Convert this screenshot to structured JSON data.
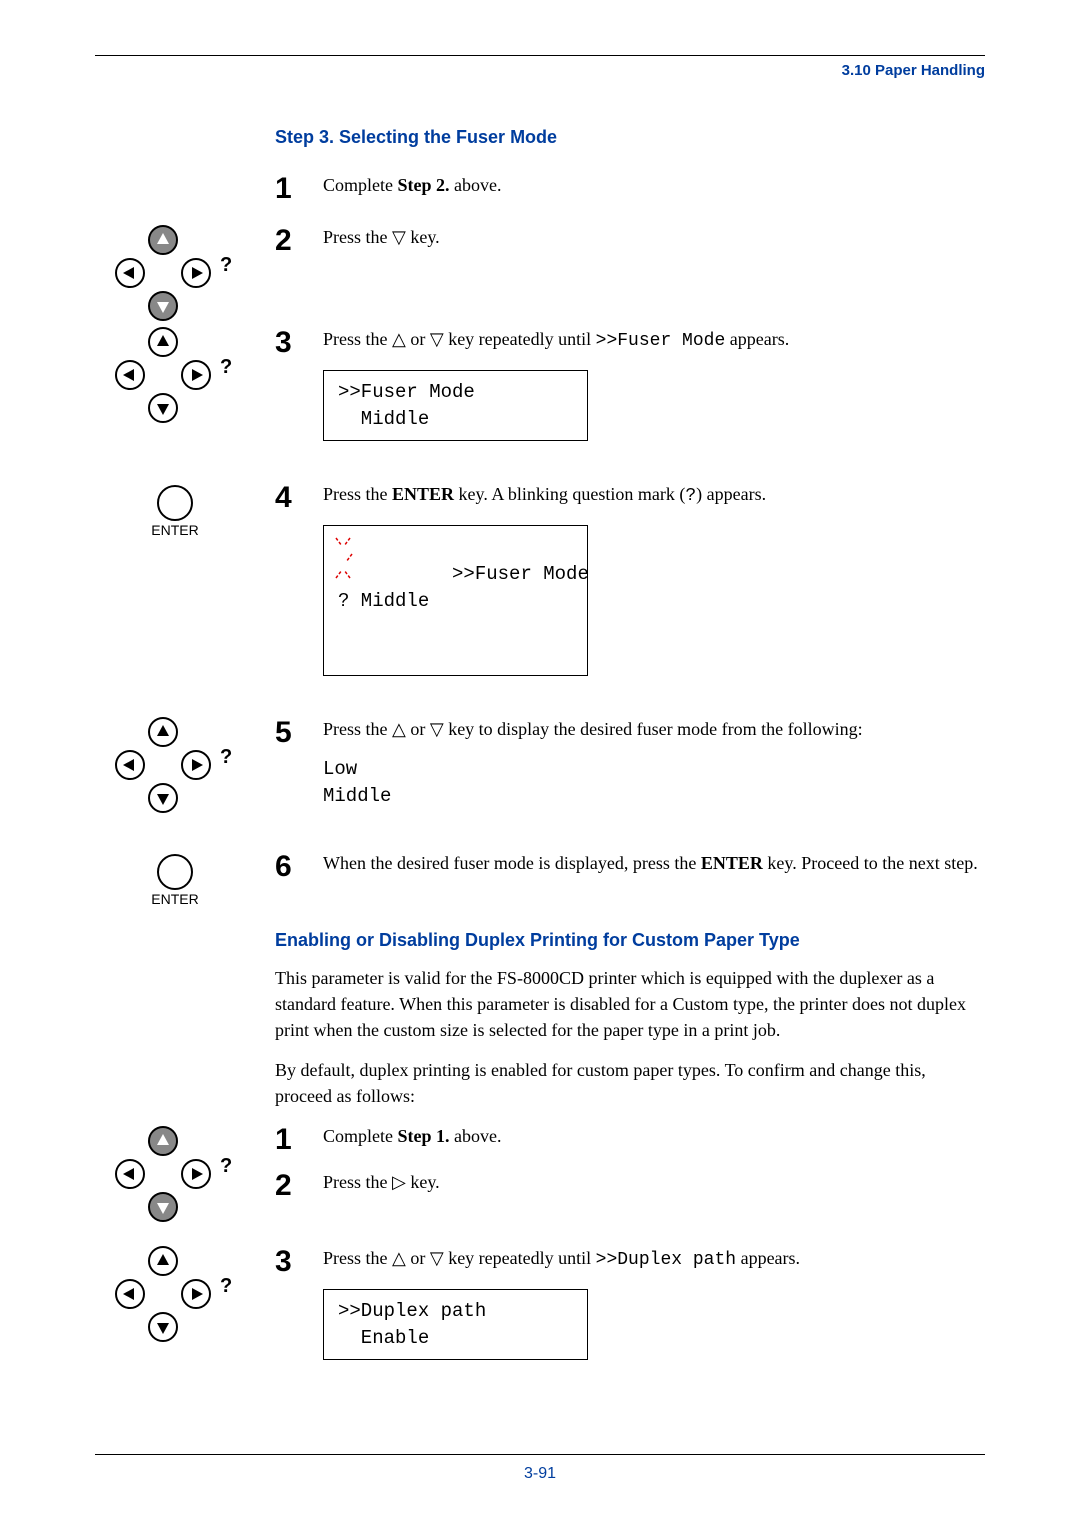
{
  "header": {
    "section_ref": "3.10 Paper Handling"
  },
  "section1": {
    "title": "Step 3. Selecting the Fuser Mode",
    "steps": [
      {
        "num": "1",
        "text_a": "Complete ",
        "bold": "Step 2.",
        "text_b": " above."
      },
      {
        "num": "2",
        "text_a": "Press the ",
        "tri": "▽",
        "text_b": " key."
      },
      {
        "num": "3",
        "text_a": "Press the ",
        "tri1": "△",
        "text_mid": " or ",
        "tri2": "▽",
        "text_b": " key repeatedly until ",
        "mono": ">>Fuser Mode",
        "text_c": " appears.",
        "display": ">>Fuser Mode\n  Middle"
      },
      {
        "num": "4",
        "text_a": "Press the ",
        "bold": "ENTER",
        "text_b": " key. A blinking question mark (",
        "mono": "?",
        "text_c": ") appears.",
        "display": ">>Fuser Mode\n? Middle"
      },
      {
        "num": "5",
        "text_a": "Press the ",
        "tri1": "△",
        "text_mid": " or ",
        "tri2": "▽",
        "text_b": " key to display the desired fuser mode from the following:",
        "options": "Low\nMiddle"
      },
      {
        "num": "6",
        "text_a": "When the desired fuser mode is displayed, press the ",
        "bold": "ENTER",
        "text_b": " key. Proceed to the next step."
      }
    ]
  },
  "section2": {
    "title": "Enabling or Disabling Duplex Printing for Custom Paper Type",
    "para1": "This parameter is valid for the FS-8000CD printer which is equipped with the duplexer as a standard feature. When this parameter is disabled for a Custom type, the printer does not duplex print when the custom size is selected for the paper type in a print job.",
    "para2": "By default, duplex printing is enabled for custom paper types. To confirm and change this, proceed as follows:",
    "steps": [
      {
        "num": "1",
        "text_a": "Complete ",
        "bold": "Step 1.",
        "text_b": " above."
      },
      {
        "num": "2",
        "text_a": "Press the ",
        "tri": "▷",
        "text_b": " key."
      },
      {
        "num": "3",
        "text_a": "Press the ",
        "tri1": "△",
        "text_mid": " or ",
        "tri2": "▽",
        "text_b": " key repeatedly until ",
        "mono": ">>Duplex path",
        "text_c": " appears.",
        "display": ">>Duplex path\n  Enable"
      }
    ]
  },
  "footer": {
    "page_number": "3-91"
  },
  "icons": {
    "enter_label": "ENTER"
  }
}
